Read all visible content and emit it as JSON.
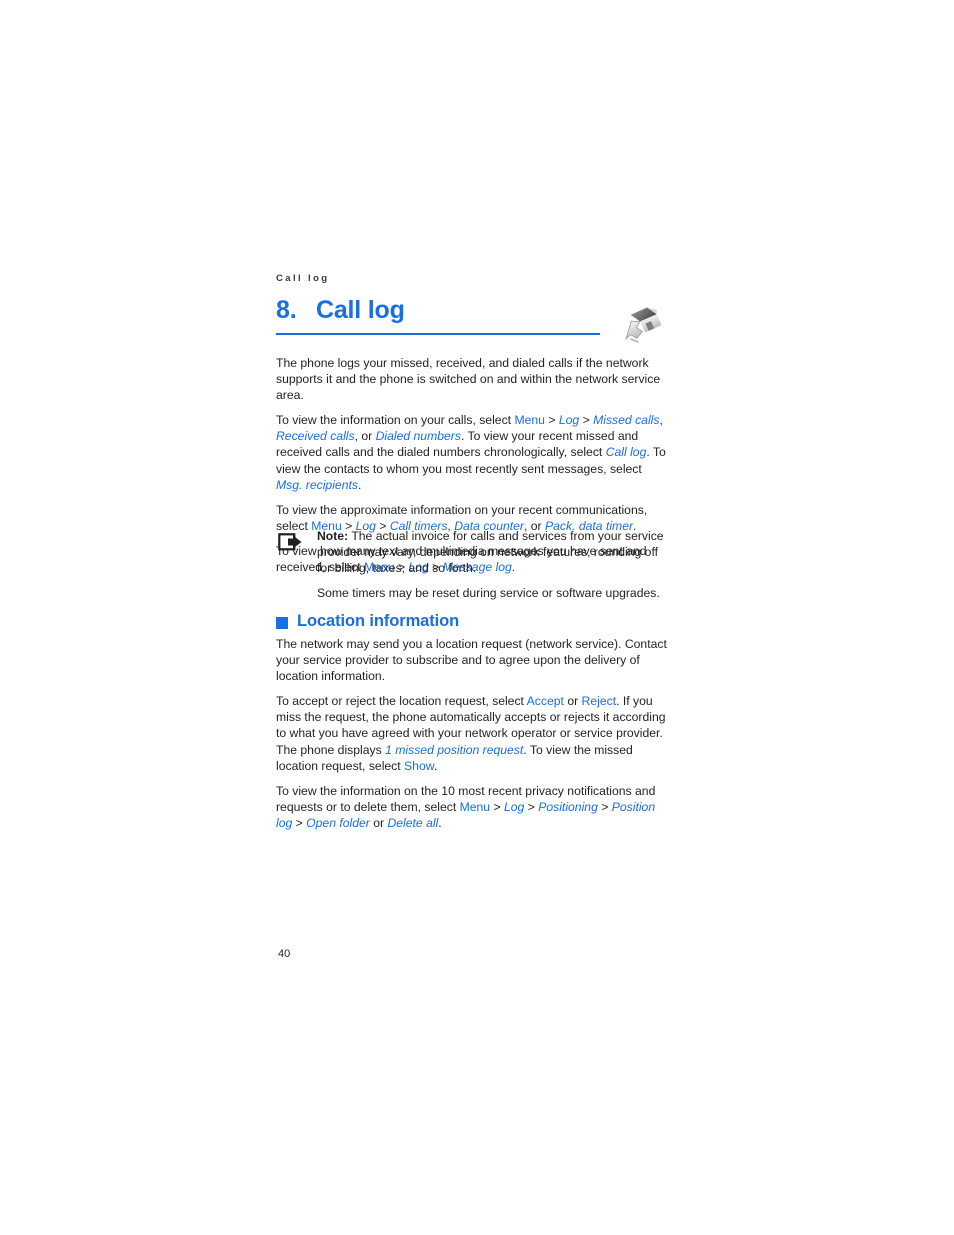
{
  "colors": {
    "accent": "#1a6ee0",
    "text": "#231f20"
  },
  "running_header": "Call log",
  "chapter": {
    "number": "8.",
    "title": "Call log",
    "icon": "house-arrow-icon"
  },
  "intro": {
    "p1": "The phone logs your missed, received, and dialed calls if the network supports it and the phone is switched on and within the network service area."
  },
  "calls_paragraph": {
    "t1": "To view the information on your calls, select ",
    "menu": "Menu",
    "sep1": " > ",
    "log": "Log",
    "sep2": " > ",
    "missed_calls": "Missed calls",
    "t2": ", ",
    "received_calls": "Received calls",
    "t3": ", or ",
    "dialed_numbers": "Dialed numbers",
    "t4": ". To view your recent missed and received calls and the dialed numbers chronologically, select ",
    "call_log": "Call log",
    "t5": ". To view the contacts to whom you most recently sent messages, select ",
    "msg_recipients": "Msg. recipients",
    "t6": "."
  },
  "timers_paragraph": {
    "t1": "To view the approximate information on your recent communications, select ",
    "menu": "Menu",
    "sep1": " > ",
    "log": "Log",
    "sep2": " > ",
    "call_timers": "Call timers",
    "t2": ", ",
    "data_counter": "Data counter",
    "t3": ", or ",
    "pack_data_timer": "Pack. data timer",
    "t4": "."
  },
  "message_log_paragraph": {
    "t1": "To view how many text and multimedia messages you have sent and received, select ",
    "menu": "Menu",
    "sep1": " > ",
    "log": "Log",
    "sep2": " > ",
    "message_log": "Message log",
    "t2": "."
  },
  "note": {
    "icon": "note-arrow-icon",
    "lead": "Note:",
    "body": " The actual invoice for calls and services from your service provider may vary, depending on network features, rounding off for billing, taxes, and so forth.",
    "second": "Some timers may be reset during service or software upgrades."
  },
  "location_section": {
    "bullet": "square-bullet-icon",
    "title": "Location information",
    "p1": "The network may send you a location request (network service). Contact your service provider to subscribe and to agree upon the delivery of location information.",
    "p2": {
      "t1": "To accept or reject the location request, select ",
      "accept": "Accept",
      "t2": " or ",
      "reject": "Reject",
      "t3": ". If you miss the request, the phone automatically accepts or rejects it according to what you have agreed with your network operator or service provider. The phone displays ",
      "missed_request": "1 missed position request",
      "t4": ". To view the missed location request, select ",
      "show": "Show",
      "t5": "."
    },
    "p3": {
      "t1": "To view the information on the 10 most recent privacy notifications and requests or to delete them, select ",
      "menu": "Menu",
      "sep1": " > ",
      "log": "Log",
      "sep2": " > ",
      "positioning": "Positioning",
      "sep3": " > ",
      "position_log": "Position log",
      "sep4": " > ",
      "open_folder": "Open folder",
      "t2": " or ",
      "delete_all": "Delete all",
      "t3": "."
    }
  },
  "folio": "40"
}
